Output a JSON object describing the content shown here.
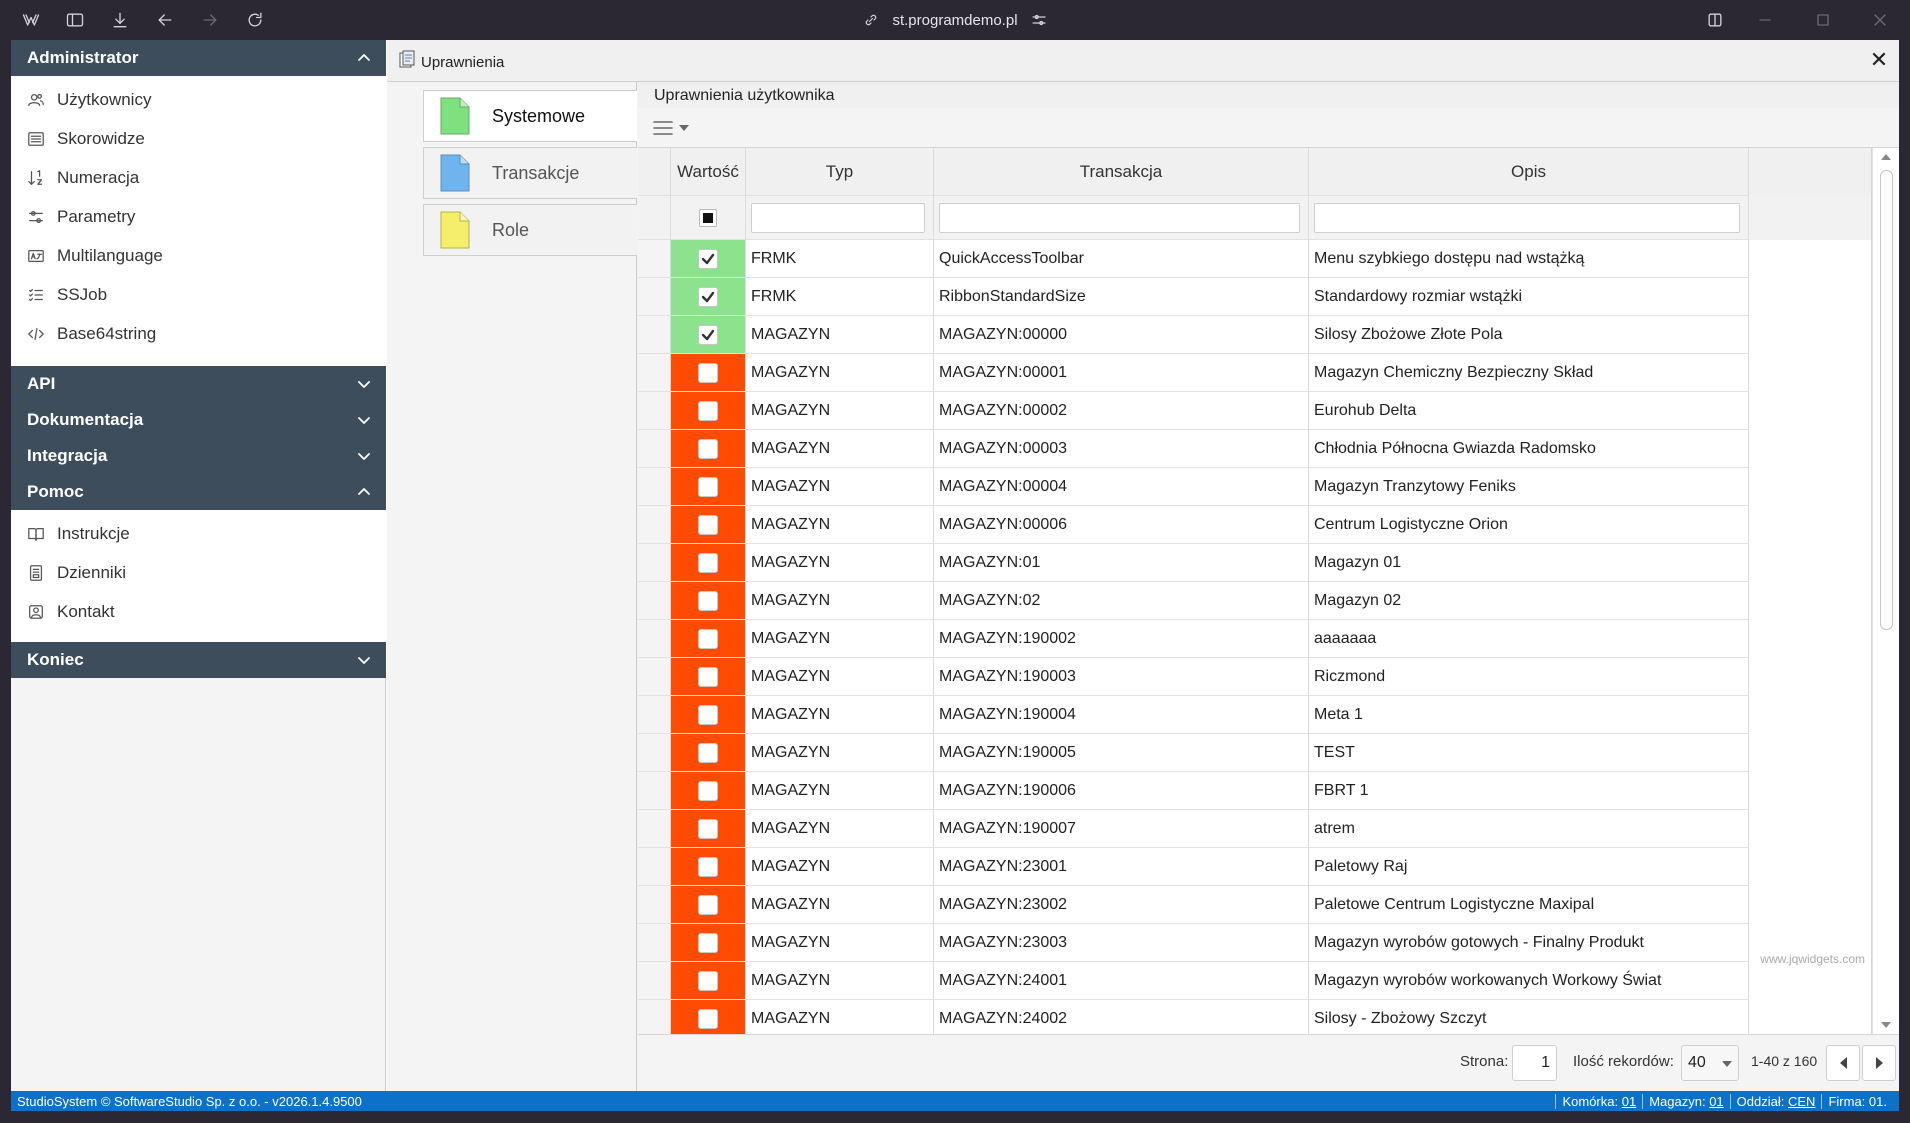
{
  "browser": {
    "url": "st.programdemo.pl"
  },
  "sidebar": {
    "sections": [
      {
        "id": "administrator",
        "label": "Administrator",
        "expanded": true,
        "items": [
          {
            "label": "Użytkownicy",
            "icon": "users-icon"
          },
          {
            "label": "Skorowidze",
            "icon": "list-icon"
          },
          {
            "label": "Numeracja",
            "icon": "sort-numeric-icon"
          },
          {
            "label": "Parametry",
            "icon": "sliders-icon"
          },
          {
            "label": "Multilanguage",
            "icon": "language-icon"
          },
          {
            "label": "SSJob",
            "icon": "task-list-icon"
          },
          {
            "label": "Base64string",
            "icon": "code-icon"
          }
        ]
      },
      {
        "id": "api",
        "label": "API",
        "expanded": false,
        "items": []
      },
      {
        "id": "dokumentacja",
        "label": "Dokumentacja",
        "expanded": false,
        "items": []
      },
      {
        "id": "integracja",
        "label": "Integracja",
        "expanded": false,
        "items": []
      },
      {
        "id": "pomoc",
        "label": "Pomoc",
        "expanded": true,
        "items": [
          {
            "label": "Instrukcje",
            "icon": "book-icon"
          },
          {
            "label": "Dzienniki",
            "icon": "journal-icon"
          },
          {
            "label": "Kontakt",
            "icon": "contact-icon"
          }
        ]
      },
      {
        "id": "koniec",
        "label": "Koniec",
        "expanded": false,
        "items": []
      }
    ]
  },
  "panel": {
    "title": "Uprawnienia",
    "close_label": "✕",
    "tabs": [
      {
        "label": "Systemowe",
        "active": true,
        "color": "#7ee07e"
      },
      {
        "label": "Transakcje",
        "active": false,
        "color": "#6fb4ee"
      },
      {
        "label": "Role",
        "active": false,
        "color": "#f4ee6a"
      }
    ]
  },
  "grid": {
    "caption": "Uprawnienia użytkownika",
    "columns": [
      "Wartość",
      "Typ",
      "Transakcja",
      "Opis"
    ],
    "rows": [
      {
        "value": true,
        "typ": "FRMK",
        "transakcja": "QuickAccessToolbar",
        "opis": "Menu szybkiego dostępu nad wstążką"
      },
      {
        "value": true,
        "typ": "FRMK",
        "transakcja": "RibbonStandardSize",
        "opis": "Standardowy rozmiar wstążki"
      },
      {
        "value": true,
        "typ": "MAGAZYN",
        "transakcja": "MAGAZYN:00000",
        "opis": "Silosy Zbożowe Złote Pola"
      },
      {
        "value": false,
        "typ": "MAGAZYN",
        "transakcja": "MAGAZYN:00001",
        "opis": "Magazyn Chemiczny Bezpieczny Skład"
      },
      {
        "value": false,
        "typ": "MAGAZYN",
        "transakcja": "MAGAZYN:00002",
        "opis": "Eurohub Delta"
      },
      {
        "value": false,
        "typ": "MAGAZYN",
        "transakcja": "MAGAZYN:00003",
        "opis": "Chłodnia Północna Gwiazda Radomsko"
      },
      {
        "value": false,
        "typ": "MAGAZYN",
        "transakcja": "MAGAZYN:00004",
        "opis": "Magazyn Tranzytowy Feniks"
      },
      {
        "value": false,
        "typ": "MAGAZYN",
        "transakcja": "MAGAZYN:00006",
        "opis": "Centrum Logistyczne Orion"
      },
      {
        "value": false,
        "typ": "MAGAZYN",
        "transakcja": "MAGAZYN:01",
        "opis": "Magazyn 01"
      },
      {
        "value": false,
        "typ": "MAGAZYN",
        "transakcja": "MAGAZYN:02",
        "opis": "Magazyn 02"
      },
      {
        "value": false,
        "typ": "MAGAZYN",
        "transakcja": "MAGAZYN:190002",
        "opis": "aaaaaaa"
      },
      {
        "value": false,
        "typ": "MAGAZYN",
        "transakcja": "MAGAZYN:190003",
        "opis": "Riczmond"
      },
      {
        "value": false,
        "typ": "MAGAZYN",
        "transakcja": "MAGAZYN:190004",
        "opis": "Meta 1"
      },
      {
        "value": false,
        "typ": "MAGAZYN",
        "transakcja": "MAGAZYN:190005",
        "opis": "TEST"
      },
      {
        "value": false,
        "typ": "MAGAZYN",
        "transakcja": "MAGAZYN:190006",
        "opis": "FBRT 1"
      },
      {
        "value": false,
        "typ": "MAGAZYN",
        "transakcja": "MAGAZYN:190007",
        "opis": "atrem"
      },
      {
        "value": false,
        "typ": "MAGAZYN",
        "transakcja": "MAGAZYN:23001",
        "opis": "Paletowy Raj"
      },
      {
        "value": false,
        "typ": "MAGAZYN",
        "transakcja": "MAGAZYN:23002",
        "opis": "Paletowe Centrum Logistyczne Maxipal"
      },
      {
        "value": false,
        "typ": "MAGAZYN",
        "transakcja": "MAGAZYN:23003",
        "opis": "Magazyn wyrobów gotowych - Finalny Produkt"
      },
      {
        "value": false,
        "typ": "MAGAZYN",
        "transakcja": "MAGAZYN:24001",
        "opis": "Magazyn wyrobów workowanych Workowy Świat"
      },
      {
        "value": false,
        "typ": "MAGAZYN",
        "transakcja": "MAGAZYN:24002",
        "opis": "Silosy - Zbożowy Szczyt"
      }
    ],
    "value_colors": {
      "on": "#8de38d",
      "off": "#ff4c00"
    },
    "watermark": "www.jqwidgets.com"
  },
  "pager": {
    "page_label": "Strona:",
    "page_value": "1",
    "size_label": "Ilość rekordów:",
    "size_value": "40",
    "range_text": "1-40 z 160"
  },
  "status": {
    "left": "StudioSystem © SoftwareStudio Sp. z o.o. - v2026.1.4.9500",
    "komorka_label": "Komórka:",
    "komorka_value": "01",
    "magazyn_label": "Magazyn:",
    "magazyn_value": "01",
    "oddzial_label": "Oddział:",
    "oddzial_value": "CEN",
    "firma_label": "Firma:",
    "firma_value": "01."
  }
}
